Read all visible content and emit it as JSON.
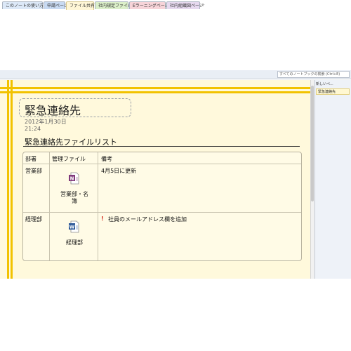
{
  "tabs": [
    {
      "label": "このノートの使い方"
    },
    {
      "label": "申請ページ"
    },
    {
      "label": "ファイル共有"
    },
    {
      "label": "社内規定ファイル"
    },
    {
      "label": "Eラーニングページ"
    },
    {
      "label": "社内組織図ページ"
    }
  ],
  "add_tab": "+",
  "search": {
    "placeholder": "すべてのノートブックの検索 (Ctrl+E)"
  },
  "page": {
    "title": "緊急連絡先",
    "date": "2012年1月30日",
    "time": "21:24",
    "subtitle": "緊急連絡先ファイルリスト"
  },
  "table": {
    "headers": [
      "部署",
      "管理ファイル",
      "備考"
    ],
    "rows": [
      {
        "dept": "営業部",
        "file_label_1": "営業部・名",
        "file_label_2": "簿",
        "file_icon": "onenote-file-icon",
        "note": "4月5日に更新"
      },
      {
        "dept": "経理部",
        "file_label_1": "経理部",
        "file_icon": "word-file-icon",
        "note_marker": "!",
        "note": "社員のメールアドレス欄を追加"
      }
    ]
  },
  "sidepanel": {
    "new_page_button": "新しいペ...",
    "pages": [
      "緊急連絡先"
    ]
  },
  "colors": {
    "page_bg": "#fff9dc",
    "stripe": "#f2c200",
    "note_marker": "#d42b1e"
  }
}
